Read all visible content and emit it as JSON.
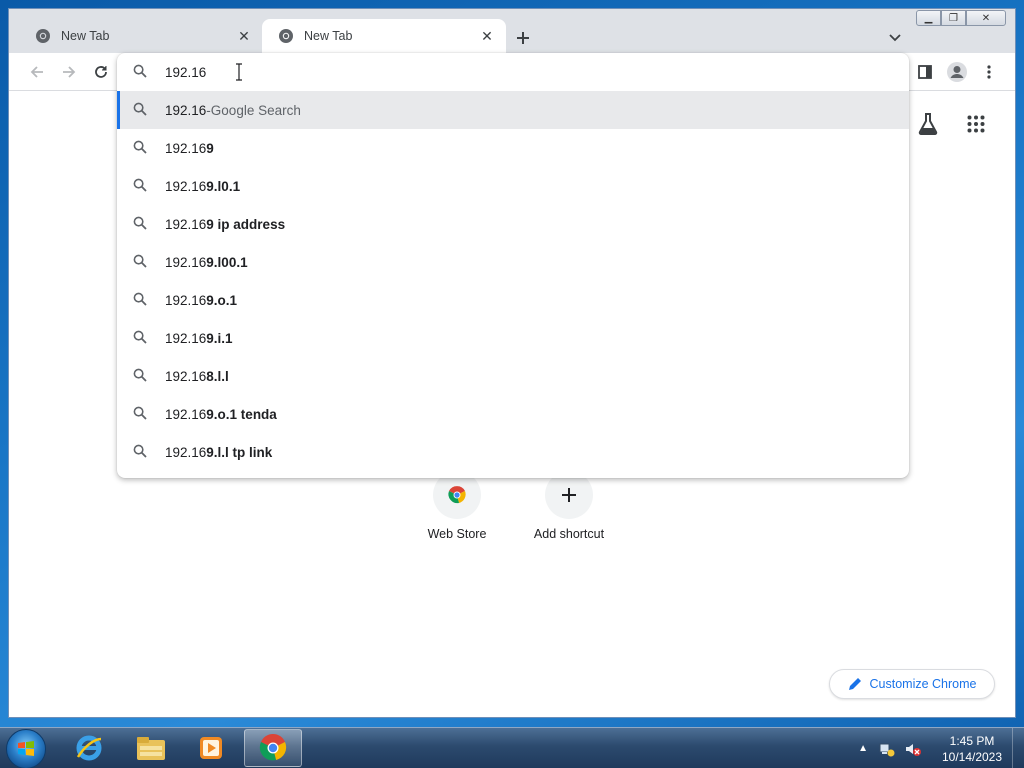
{
  "browser": {
    "tabs": [
      {
        "title": "New Tab",
        "active": false
      },
      {
        "title": "New Tab",
        "active": true
      }
    ]
  },
  "omnibox": {
    "input_value": "192.16",
    "suggestions": [
      {
        "typed": "192.16",
        "rest": "",
        "separator": " - ",
        "engine": "Google Search",
        "kind": "search-what-you-typed"
      },
      {
        "typed": "192.16",
        "rest": "9"
      },
      {
        "typed": "192.16",
        "rest": "9.l0.1"
      },
      {
        "typed": "192.16",
        "rest": "9 ip address"
      },
      {
        "typed": "192.16",
        "rest": "9.l00.1"
      },
      {
        "typed": "192.16",
        "rest": "9.o.1"
      },
      {
        "typed": "192.16",
        "rest": "9.i.1"
      },
      {
        "typed": "192.16",
        "rest": "8.l.l"
      },
      {
        "typed": "192.16",
        "rest": "9.o.1 tenda"
      },
      {
        "typed": "192.16",
        "rest": "9.l.l tp link"
      }
    ]
  },
  "ntp": {
    "shortcuts": [
      {
        "label": "Web Store",
        "icon": "chrome-web-store-icon"
      },
      {
        "label": "Add shortcut",
        "icon": "plus-icon"
      }
    ],
    "customize_label": "Customize Chrome"
  },
  "taskbar": {
    "apps": [
      "internet-explorer-icon",
      "file-explorer-icon",
      "media-player-icon",
      "chrome-icon"
    ],
    "active_app": "chrome-icon",
    "time": "1:45 PM",
    "date": "10/14/2023"
  },
  "colors": {
    "accent": "#1a73e8",
    "tab_strip": "#dee1e6",
    "selected_row": "#e8e9eb"
  }
}
